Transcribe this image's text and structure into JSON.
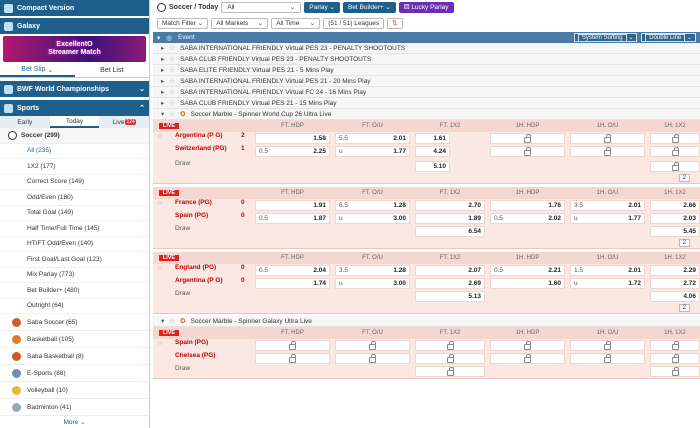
{
  "sidebar": {
    "compact": "Compact Version",
    "galaxy": "Galaxy",
    "banner": [
      "ExcellentO",
      "Streamer Match"
    ],
    "betslip": "Bet Slip",
    "betlist": "Bet List",
    "bwf": "BWF World Championships",
    "sports": "Sports",
    "early": "Early",
    "today": "Today",
    "live": "Live",
    "live_count": "124",
    "soccer": "Soccer (299)",
    "items": [
      "All (235)",
      "1X2 (177)",
      "Correct Score (149)",
      "Odd/Even (180)",
      "Total Goal (149)",
      "Half Time/Full Time (145)",
      "HT/FT Odd/Even (140)",
      "First Goal/Last Goal (123)",
      "Mix Parlay (773)",
      "Bet Builder+ (480)",
      "Outright (64)"
    ],
    "sports_list": [
      {
        "label": "Saba Soccer (65)",
        "color": "#d35b2c"
      },
      {
        "label": "Basketball (105)",
        "color": "#e07a2e"
      },
      {
        "label": "Saba Basketball (8)",
        "color": "#c85a2a"
      },
      {
        "label": "E-Sports (88)",
        "color": "#6a8fb7"
      },
      {
        "label": "Volleyball (10)",
        "color": "#e7b83a"
      },
      {
        "label": "Badminton (41)",
        "color": "#9aa7b5"
      }
    ],
    "more": "More"
  },
  "top": {
    "title": "Soccer / Today",
    "select": "All",
    "parlay": "Parlay",
    "betbuilder": "Bet Builder+",
    "lucky": "Lucky Parlay"
  },
  "filters": {
    "match": "Match Filter",
    "markets": "All Markets",
    "time": "All Time",
    "leagues": "(51 / 51) Leagues"
  },
  "event": {
    "label": "Event",
    "sorting": "System Sorting",
    "line": "Double Line"
  },
  "competitions": [
    "SABA INTERNATIONAL FRIENDLY Virtual PES 23 - PENALTY SHOOTOUTS",
    "SABA CLUB FRIENDLY Virtual PES 23 - PENALTY SHOOTOUTS",
    "SABA ELITE FRIENDLY Virtual PES 21 - 5 Mins Play",
    "SABA INTERNATIONAL FRIENDLY Virtual PES 21 - 20 Mins Play",
    "SABA INTERNATIONAL FRIENDLY Virtual FC 24 - 16 Mins Play",
    "SABA CLUB FRIENDLY Virtual PES 21 - 15 Mins Play"
  ],
  "league1": "Soccer Marble - Spinner World Cup 26 Ultra Live",
  "league2": "Soccer Marble - Spinner Galaxy Ultra Live",
  "cols": [
    "FT. HDP",
    "FT. O/U",
    "FT. 1X2",
    "1H. HDP",
    "1H. O/U",
    "1H. 1X2"
  ],
  "live": "LIVE",
  "draw": "Draw",
  "pager": "2",
  "matches": [
    {
      "home": "Argentina (P G)",
      "away": "Switzerland (PG)",
      "hs": "2",
      "as": "1",
      "h": {
        "hdp_l": "",
        "hdp": "1.58",
        "ou_l": "5.5",
        "ou": "2.01",
        "x": "1.61"
      },
      "a": {
        "hdp_l": "0.5",
        "hdp": "2.25",
        "ou_l": "u",
        "ou": "1.77",
        "x": "4.24"
      },
      "d": "5.10",
      "h1": "lock"
    },
    {
      "home": "France (PG)",
      "away": "Spain (PG)",
      "hs": "0",
      "as": "0",
      "h": {
        "hdp_l": "",
        "hdp": "1.91",
        "ou_l": "6.5",
        "ou": "1.28",
        "x": "2.70",
        "h1hdp": "1.76",
        "h1ou_l": "3.5",
        "h1ou": "2.01",
        "h1x": "2.66"
      },
      "a": {
        "hdp_l": "0.5",
        "hdp": "1.87",
        "ou_l": "u",
        "ou": "3.00",
        "x": "1.89",
        "h1hdp_l": "0.5",
        "h1hdp": "2.02",
        "h1ou_l": "u",
        "h1ou": "1.77",
        "h1x": "2.03"
      },
      "d": "6.54",
      "d1": "5.45"
    },
    {
      "home": "England (PG)",
      "away": "Argentina (P G)",
      "hs": "0",
      "as": "0",
      "h": {
        "hdp_l": "0.5",
        "hdp": "2.04",
        "ou_l": "3.5",
        "ou": "1.28",
        "x": "2.07",
        "h1hdp_l": "0.5",
        "h1hdp": "2.21",
        "h1ou_l": "1.5",
        "h1ou": "2.01",
        "h1x": "2.29"
      },
      "a": {
        "hdp_l": "",
        "hdp": "1.74",
        "ou_l": "u",
        "ou": "3.00",
        "x": "2.69",
        "h1hdp": "1.60",
        "h1ou_l": "u",
        "h1ou": "1.72",
        "h1x": "2.72"
      },
      "d": "5.13",
      "d1": "4.06"
    },
    {
      "home": "Spain (PG)",
      "away": "Chelsea (PG)"
    }
  ]
}
